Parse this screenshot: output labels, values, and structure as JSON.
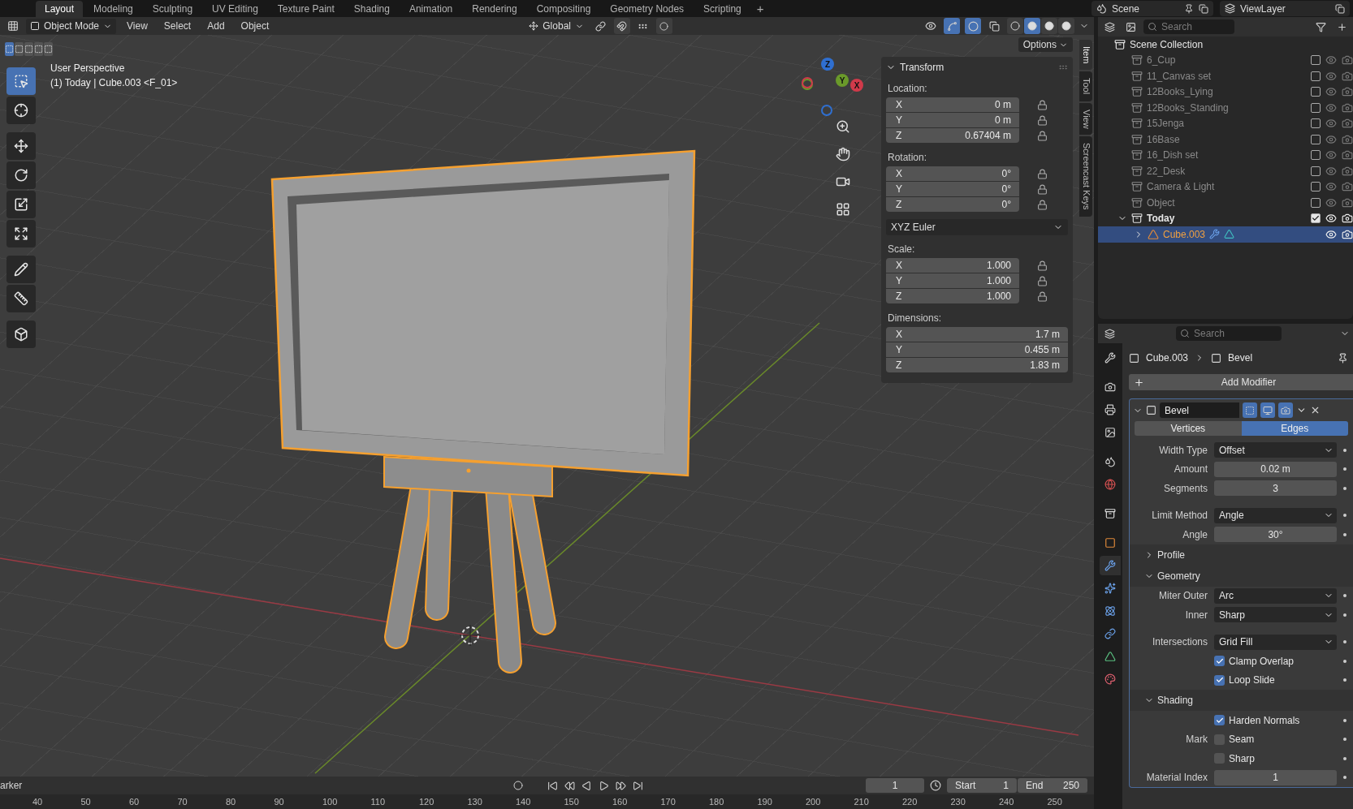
{
  "workspace_tabs": [
    {
      "label": "Layout",
      "selected": true
    },
    {
      "label": "Modeling",
      "selected": false
    },
    {
      "label": "Sculpting",
      "selected": false
    },
    {
      "label": "UV Editing",
      "selected": false
    },
    {
      "label": "Texture Paint",
      "selected": false
    },
    {
      "label": "Shading",
      "selected": false
    },
    {
      "label": "Animation",
      "selected": false
    },
    {
      "label": "Rendering",
      "selected": false
    },
    {
      "label": "Compositing",
      "selected": false
    },
    {
      "label": "Geometry Nodes",
      "selected": false
    },
    {
      "label": "Scripting",
      "selected": false
    }
  ],
  "add_workspace": "+",
  "scene": "Scene",
  "view_layer": "ViewLayer",
  "viewport_header": {
    "mode": "Object Mode",
    "menus": [
      "View",
      "Select",
      "Add",
      "Object"
    ],
    "orientation": "Global",
    "options": "Options",
    "select_modes": [
      {
        "selected": true
      },
      {
        "selected": false
      },
      {
        "selected": false
      },
      {
        "selected": false
      },
      {
        "selected": false
      }
    ],
    "shading_modes": [
      {
        "selected": false
      },
      {
        "selected": true
      },
      {
        "selected": false
      },
      {
        "selected": false
      }
    ]
  },
  "tools": [
    {
      "kind": "select",
      "selected": true
    },
    {
      "kind": "cursor",
      "selected": false
    },
    {
      "kind": "move",
      "selected": false
    },
    {
      "kind": "rotate",
      "selected": false
    },
    {
      "kind": "scale",
      "selected": false
    },
    {
      "kind": "transform",
      "selected": false
    },
    {
      "kind": "annotate",
      "selected": false
    },
    {
      "kind": "measure",
      "selected": false
    },
    {
      "kind": "add_cube",
      "selected": false
    }
  ],
  "viewport": {
    "title": "User Perspective",
    "subtitle": "(1) Today | Cube.003 <F_01>",
    "gizmo": [
      {
        "label": "Z",
        "color": "#2f6fd0"
      },
      {
        "label": "Y",
        "color": "#6a9a2a"
      },
      {
        "label": "X",
        "color": "#d03a4a"
      }
    ]
  },
  "sidebar": {
    "panel": "Transform",
    "items": [
      {
        "kind": "group",
        "label": "Location:",
        "locks": true,
        "fields": [
          {
            "axis": "X",
            "value": "0 m"
          },
          {
            "axis": "Y",
            "value": "0 m"
          },
          {
            "axis": "Z",
            "value": "0.67404 m"
          }
        ]
      },
      {
        "kind": "group",
        "label": "Rotation:",
        "locks": true,
        "fields": [
          {
            "axis": "X",
            "value": "0°"
          },
          {
            "axis": "Y",
            "value": "0°"
          },
          {
            "axis": "Z",
            "value": "0°"
          }
        ]
      },
      {
        "kind": "dropdown",
        "value": "XYZ Euler"
      },
      {
        "kind": "group",
        "label": "Scale:",
        "locks": true,
        "fields": [
          {
            "axis": "X",
            "value": "1.000"
          },
          {
            "axis": "Y",
            "value": "1.000"
          },
          {
            "axis": "Z",
            "value": "1.000"
          }
        ]
      },
      {
        "kind": "group",
        "label": "Dimensions:",
        "locks": false,
        "fields": [
          {
            "axis": "X",
            "value": "1.7 m"
          },
          {
            "axis": "Y",
            "value": "0.455 m"
          },
          {
            "axis": "Z",
            "value": "1.83 m"
          }
        ]
      }
    ],
    "tabs": [
      {
        "label": "Item",
        "selected": true
      },
      {
        "label": "Tool",
        "selected": false
      },
      {
        "label": "View",
        "selected": false
      },
      {
        "label": "Screencast Keys",
        "selected": false
      }
    ]
  },
  "outliner": {
    "search": {
      "placeholder": "Search"
    },
    "root": {
      "name": "Scene Collection",
      "children": [
        {
          "kind": "collection",
          "name": "6_Cup",
          "checked": false
        },
        {
          "kind": "collection",
          "name": "11_Canvas set",
          "checked": false
        },
        {
          "kind": "collection",
          "name": "12Books_Lying",
          "checked": false
        },
        {
          "kind": "collection",
          "name": "12Books_Standing",
          "checked": false
        },
        {
          "kind": "collection",
          "name": "15Jenga",
          "checked": false
        },
        {
          "kind": "collection",
          "name": "16Base",
          "checked": false
        },
        {
          "kind": "collection",
          "name": "16_Dish set",
          "checked": false
        },
        {
          "kind": "collection",
          "name": "22_Desk",
          "checked": false
        },
        {
          "kind": "collection",
          "name": "Camera & Light",
          "checked": false
        },
        {
          "kind": "collection",
          "name": "Object",
          "checked": false
        },
        {
          "kind": "collection",
          "name": "Today",
          "checked": true,
          "expanded": true,
          "children": [
            {
              "kind": "object",
              "name": "Cube.003",
              "selected": true,
              "expanded": false
            }
          ]
        }
      ]
    }
  },
  "properties": {
    "search": {
      "placeholder": "Search"
    },
    "tabs": [
      {
        "kind": "tool",
        "selected": false
      },
      {
        "kind": "render",
        "selected": false
      },
      {
        "kind": "output",
        "selected": false
      },
      {
        "kind": "view_layer",
        "selected": false
      },
      {
        "kind": "scene",
        "selected": false
      },
      {
        "kind": "world",
        "selected": false
      },
      {
        "kind": "collection",
        "selected": false
      },
      {
        "kind": "object",
        "selected": false
      },
      {
        "kind": "modifiers",
        "selected": true
      },
      {
        "kind": "particles",
        "selected": false
      },
      {
        "kind": "physics",
        "selected": false
      },
      {
        "kind": "constraints",
        "selected": false
      },
      {
        "kind": "data",
        "selected": false
      },
      {
        "kind": "material",
        "selected": false
      }
    ],
    "breadcrumb": [
      "Cube.003",
      "Bevel"
    ],
    "add_modifier": "Add Modifier",
    "modifier": {
      "name": "Bevel",
      "expanded": true,
      "affect": [
        {
          "label": "Vertices",
          "selected": false
        },
        {
          "label": "Edges",
          "selected": true
        }
      ],
      "rows": [
        {
          "kind": "dropdown",
          "label": "Width Type",
          "value": "Offset"
        },
        {
          "kind": "number",
          "label": "Amount",
          "value": "0.02 m"
        },
        {
          "kind": "number",
          "label": "Segments",
          "value": "3"
        },
        {
          "kind": "dropdown",
          "label": "Limit Method",
          "value": "Angle",
          "spaced": true
        },
        {
          "kind": "number",
          "label": "Angle",
          "value": "30°"
        },
        {
          "kind": "section",
          "label": "Profile",
          "expanded": false
        },
        {
          "kind": "section",
          "label": "Geometry",
          "expanded": true
        },
        {
          "kind": "dropdown",
          "label": "Miter Outer",
          "value": "Arc"
        },
        {
          "kind": "dropdown",
          "label": "Inner",
          "value": "Sharp"
        },
        {
          "kind": "dropdown",
          "label": "Intersections",
          "value": "Grid Fill",
          "spaced": true
        },
        {
          "kind": "checkbox",
          "text": "Clamp Overlap",
          "checked": true
        },
        {
          "kind": "checkbox",
          "text": "Loop Slide",
          "checked": true
        },
        {
          "kind": "section",
          "label": "Shading",
          "expanded": true
        },
        {
          "kind": "checkbox",
          "text": "Harden Normals",
          "checked": true
        },
        {
          "kind": "checkbox",
          "label": "Mark",
          "text": "Seam",
          "checked": false
        },
        {
          "kind": "checkbox",
          "text": "Sharp",
          "checked": false
        },
        {
          "kind": "number",
          "label": "Material Index",
          "value": "1"
        }
      ]
    }
  },
  "timeline": {
    "marker": "arker",
    "current_frame": "1",
    "start_label": "Start",
    "start": "1",
    "end_label": "End",
    "end": "250",
    "ruler": [
      "40",
      "50",
      "60",
      "70",
      "80",
      "90",
      "100",
      "110",
      "120",
      "130",
      "140",
      "150",
      "160",
      "170",
      "180",
      "190",
      "200",
      "210",
      "220",
      "230",
      "240",
      "250"
    ]
  }
}
